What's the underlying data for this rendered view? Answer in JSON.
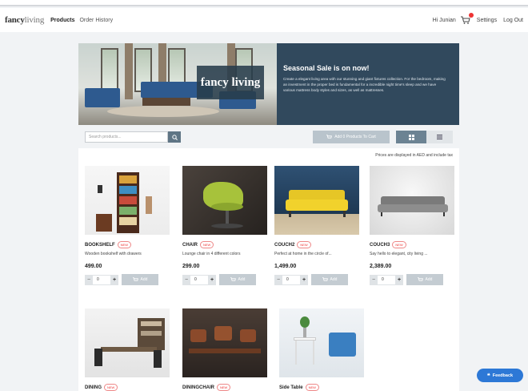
{
  "nav": {
    "logo_bold": "fancy",
    "logo_light": "living",
    "links": [
      "Products",
      "Order History"
    ],
    "user_greeting": "Hi Junian",
    "settings_label": "Settings",
    "logout_label": "Log Out"
  },
  "banner": {
    "logo_text": "fancy living",
    "title": "Seasonal Sale is on now!",
    "description": "Create a elegant living area with our stunning and giant fixtures collection. For the bedroom, making an investment in the proper bed is fundamental for a incredible night time's sleep and we have various mattress body styles and sizes, as well as mattresses."
  },
  "toolbar": {
    "search_placeholder": "Search products...",
    "add_all_label": "Add 0 Products To Cart"
  },
  "price_note": "Prices are displayed in AED and include tax",
  "products": [
    {
      "name": "BOOKSHELF",
      "badge": "NEW",
      "description": "Wooden bookshelf with drawers",
      "price": "499.00",
      "qty": "0",
      "add_label": "Add"
    },
    {
      "name": "CHAIR",
      "badge": "NEW",
      "description": "Lounge chair in 4 different colors",
      "price": "299.00",
      "qty": "0",
      "add_label": "Add"
    },
    {
      "name": "COUCH2",
      "badge": "NEW",
      "description": "Perfect at home in the circle of...",
      "price": "1,499.00",
      "qty": "0",
      "add_label": "Add"
    },
    {
      "name": "COUCH3",
      "badge": "NEW",
      "description": "Say hello to elegant, city living ...",
      "price": "2,389.00",
      "qty": "0",
      "add_label": "Add"
    },
    {
      "name": "DINING",
      "badge": "NEW"
    },
    {
      "name": "DININGCHAIR",
      "badge": "NEW"
    },
    {
      "name": "Side Table",
      "badge": "NEW"
    }
  ],
  "feedback_label": "Feedback",
  "icons": {
    "search": "search-icon",
    "cart": "cart-icon",
    "grid": "grid-view-icon",
    "list": "list-view-icon",
    "feedback": "quote-icon"
  },
  "colors": {
    "banner_bg": "#31495d",
    "accent": "#2d78d6",
    "badge": "#e33333"
  }
}
